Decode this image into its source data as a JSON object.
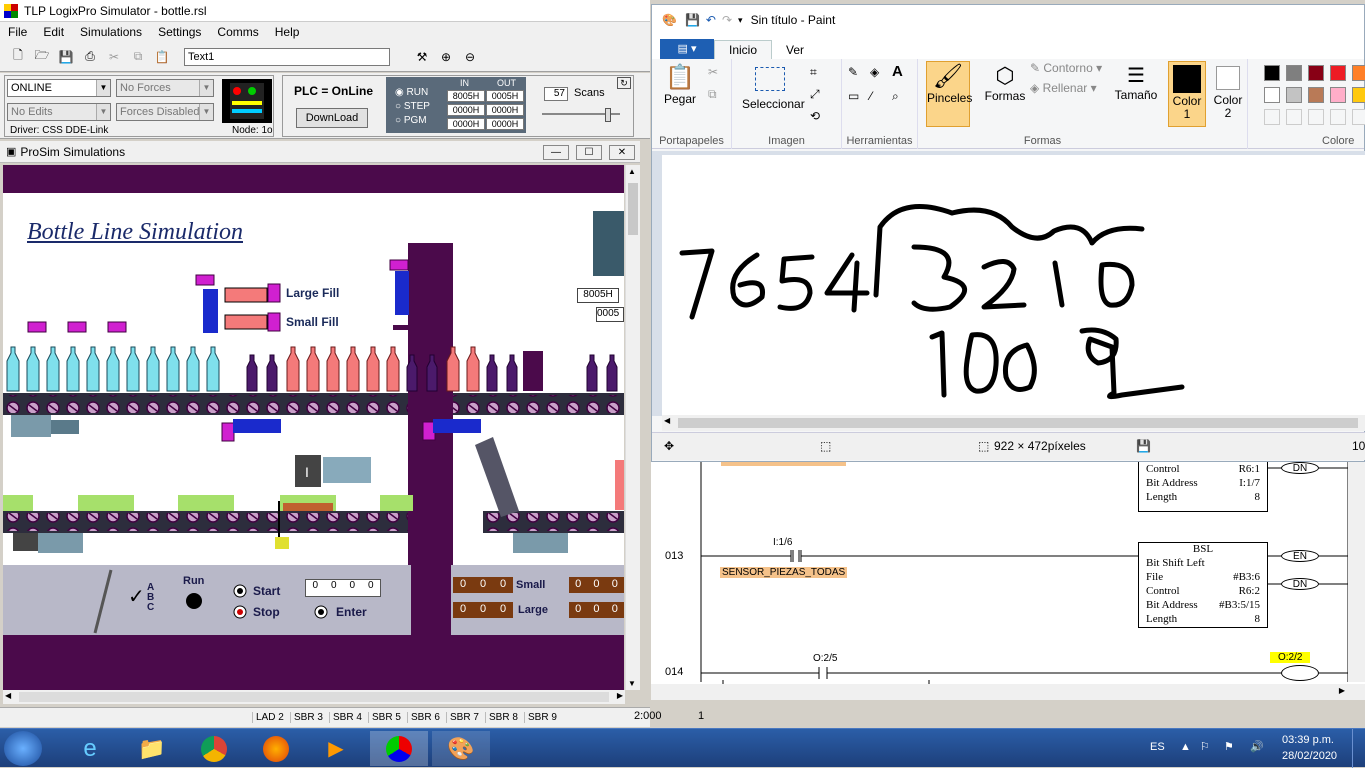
{
  "tlp": {
    "title": "TLP LogixPro Simulator  -  bottle.rsl",
    "menu": [
      "File",
      "Edit",
      "Simulations",
      "Settings",
      "Comms",
      "Help"
    ],
    "text_field": "Text1",
    "mode": "ONLINE",
    "forces": "No Forces",
    "edits": "No Edits",
    "forces_state": "Forces Disabled",
    "driver": "Driver: CSS DDE-Link",
    "node": "Node: 1o",
    "plc_status": "PLC = OnLine",
    "download": "DownLoad",
    "run_labels": [
      "RUN",
      "STEP",
      "PGM"
    ],
    "in_header": "IN",
    "out_header": "OUT",
    "in_values": [
      "8005H",
      "0000H",
      "0000H"
    ],
    "out_values": [
      "0005H",
      "0000H",
      "0000H"
    ],
    "scans_value": "57",
    "scans_label": "Scans"
  },
  "prosim": {
    "title": "ProSim Simulations",
    "sim_title": "Bottle Line Simulation",
    "large_fill": "Large Fill",
    "small_fill": "Small Fill",
    "readout1": "8005H",
    "readout2": "0005",
    "abc": "A\nB\nC",
    "run": "Run",
    "start": "Start",
    "stop": "Stop",
    "enter": "Enter",
    "small": "Small",
    "large": "Large",
    "digits": [
      "0",
      "0",
      "0"
    ],
    "thumb_digits": [
      "0",
      "0",
      "0",
      "0"
    ]
  },
  "ladder_tabs": [
    "LAD 2",
    "SBR 3",
    "SBR 4",
    "SBR 5",
    "SBR 6",
    "SBR 7",
    "SBR 8",
    "SBR 9"
  ],
  "status_pos": "2:000",
  "status_num": "1",
  "paint": {
    "title": "Sin título - Paint",
    "tabs": [
      "Inicio",
      "Ver"
    ],
    "groups": [
      "Portapapeles",
      "Imagen",
      "Herramientas",
      "Formas",
      "Colore"
    ],
    "paste": "Pegar",
    "select": "Seleccionar",
    "brushes": "Pinceles",
    "shapes": "Formas",
    "outline": "Contorno",
    "fill": "Rellenar",
    "size": "Tamaño",
    "color1": "Color\n1",
    "color2": "Color\n2",
    "dimensions": "922 × 472píxeles",
    "zoom": "10",
    "palette": [
      "#000000",
      "#7f7f7f",
      "#880015",
      "#ed1c24",
      "#ffffff",
      "#c3c3c3",
      "#b97a57",
      "#ffaec9"
    ]
  },
  "ladder": {
    "rung_nums": [
      "013",
      "014"
    ],
    "contact_addr": "I:1/6",
    "contact_label": "SENSOR_PIEZAS_TODAS",
    "contact2_addr": "O:2/5",
    "coil_addr": "O:2/2",
    "prev_block": {
      "rows": [
        [
          "Control",
          "R6:1"
        ],
        [
          "Bit Address",
          "I:1/7"
        ],
        [
          "Length",
          "8"
        ]
      ]
    },
    "bsl": {
      "title": "BSL",
      "name": "Bit Shift Left",
      "rows": [
        [
          "File",
          "#B3:6"
        ],
        [
          "Control",
          "R6:2"
        ],
        [
          "Bit Address",
          "#B3:5/15"
        ],
        [
          "Length",
          "8"
        ]
      ]
    },
    "en": "EN",
    "dn": "DN"
  },
  "taskbar": {
    "lang": "ES",
    "time": "03:39 p.m.",
    "date": "28/02/2020"
  }
}
